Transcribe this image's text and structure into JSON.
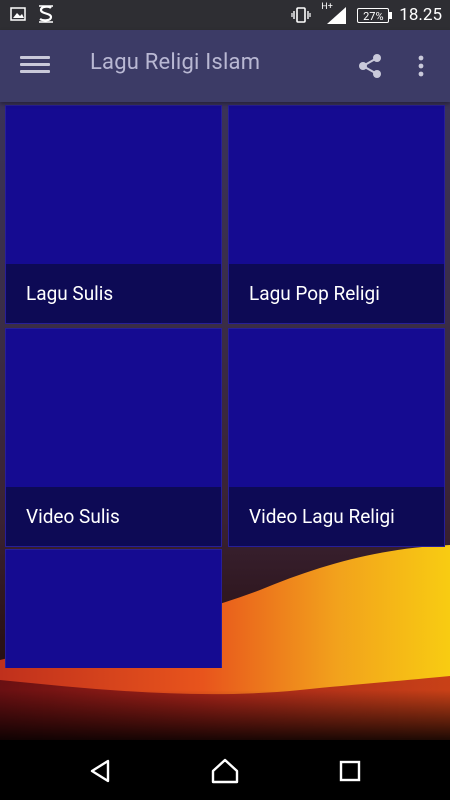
{
  "status_bar": {
    "time": "18.25",
    "battery": "27%",
    "network": "H+"
  },
  "app_bar": {
    "title": "Lagu Religi Islam"
  },
  "tiles": [
    {
      "label": "Lagu Sulis"
    },
    {
      "label": "Lagu Pop Religi"
    },
    {
      "label": "Video Sulis"
    },
    {
      "label": "Video Lagu Religi"
    },
    {
      "label": ""
    }
  ],
  "colors": {
    "app_bar": "#3c3b66",
    "tile": "#150b91",
    "tile_caption": "#0d0a55",
    "status_bar": "#2e2e33"
  },
  "icons": {
    "menu": "menu-icon",
    "share": "share-icon",
    "more": "more-vert-icon",
    "back": "back-triangle-icon",
    "home": "home-icon",
    "recents": "recents-square-icon"
  }
}
